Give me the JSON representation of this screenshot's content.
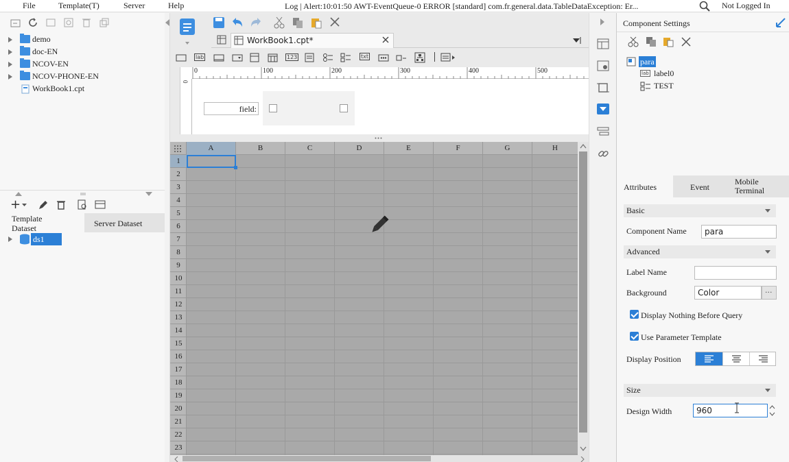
{
  "menubar": {
    "file": "File",
    "template": "Template(T)",
    "server": "Server",
    "help": "Help",
    "alert": "Log | Alert:10:01:50 AWT-EventQueue-0 ERROR [standard] com.fr.general.data.TableDataException: Er...",
    "login": "Not Logged In"
  },
  "file_tree": {
    "items": [
      {
        "label": "demo",
        "type": "folder"
      },
      {
        "label": "doc-EN",
        "type": "folder"
      },
      {
        "label": "NCOV-EN",
        "type": "folder"
      },
      {
        "label": "NCOV-PHONE-EN",
        "type": "folder"
      },
      {
        "label": "WorkBook1.cpt",
        "type": "file"
      }
    ]
  },
  "dataset": {
    "tab_template": "Template Dataset",
    "tab_server": "Server Dataset",
    "items": [
      "ds1"
    ]
  },
  "editor": {
    "tab_title": "WorkBook1.cpt*",
    "ruler_ticks": [
      "0",
      "100",
      "200",
      "300",
      "400",
      "500"
    ],
    "ruler_v": "0",
    "param_label": "field:",
    "columns": [
      "A",
      "B",
      "C",
      "D",
      "E",
      "F",
      "G",
      "H"
    ],
    "rows": [
      "1",
      "2",
      "3",
      "4",
      "5",
      "6",
      "7",
      "8",
      "9",
      "10",
      "11",
      "12",
      "13",
      "14",
      "15",
      "16",
      "17",
      "18",
      "19",
      "20",
      "21",
      "22",
      "23"
    ]
  },
  "component_settings": {
    "title": "Component Settings",
    "tree": {
      "root": "para",
      "children": [
        "label0",
        "TEST"
      ]
    }
  },
  "attributes": {
    "tabs": [
      "Attributes",
      "Event",
      "Mobile Terminal"
    ],
    "basic_header": "Basic",
    "component_name_label": "Component Name",
    "component_name_value": "para",
    "advanced_header": "Advanced",
    "label_name_label": "Label Name",
    "label_name_value": "",
    "background_label": "Background",
    "background_value": "Color",
    "display_nothing": "Display Nothing Before Query",
    "use_param_template": "Use Parameter Template",
    "display_position_label": "Display Position",
    "size_header": "Size",
    "design_width_label": "Design Width",
    "design_width_value": "960"
  },
  "colors": {
    "accent": "#2b7fd6",
    "grid_bg": "#a9a9a9",
    "folder": "#3d8ee0"
  }
}
